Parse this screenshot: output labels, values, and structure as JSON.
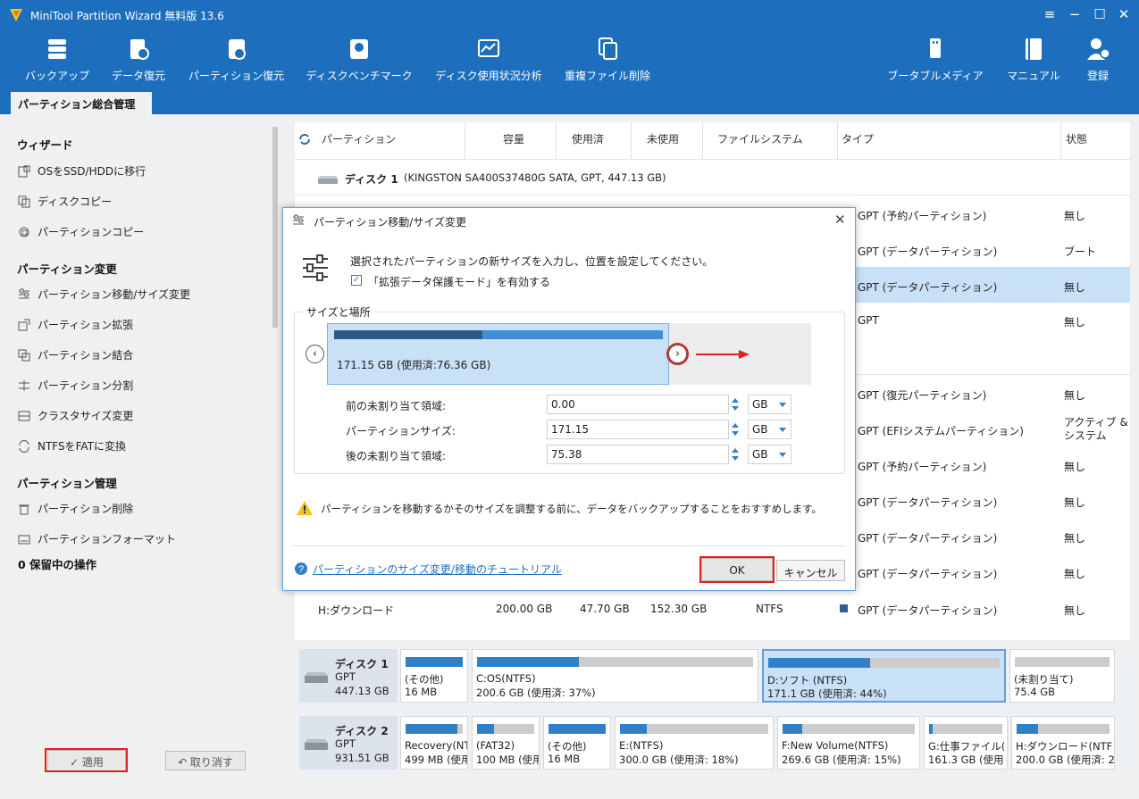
{
  "app": {
    "title": "MiniTool Partition Wizard 無料版 13.6"
  },
  "toolbar": {
    "items": [
      "バックアップ",
      "データ復元",
      "パーティション復元",
      "ディスクベンチマーク",
      "ディスク使用状況分析",
      "重複ファイル削除"
    ],
    "right_items": [
      "ブータブルメディア",
      "マニュアル",
      "登録"
    ]
  },
  "tab": {
    "label": "パーティション総合管理"
  },
  "sidebar": {
    "wizard_header": "ウィザード",
    "wizard_items": [
      "OSをSSD/HDDに移行",
      "ディスクコピー",
      "パーティションコピー"
    ],
    "change_header": "パーティション変更",
    "change_items": [
      "パーティション移動/サイズ変更",
      "パーティション拡張",
      "パーティション結合",
      "パーティション分割",
      "クラスタサイズ変更",
      "NTFSをFATに変換"
    ],
    "manage_header": "パーティション管理",
    "manage_items": [
      "パーティション削除",
      "パーティションフォーマット"
    ],
    "pending": "0 保留中の操作",
    "apply_label": "✓ 適用",
    "undo_label": "↶ 取り消す"
  },
  "table": {
    "headers": [
      "パーティション",
      "容量",
      "使用済",
      "未使用",
      "ファイルシステム",
      "タイプ",
      "状態"
    ],
    "disk1_label": "ディスク 1",
    "disk1_info": "(KINGSTON SA400S37480G SATA, GPT, 447.13 GB)",
    "rows_top": [
      {
        "type": "GPT (予約パーティション)",
        "status": "無し"
      },
      {
        "type": "GPT (データパーティション)",
        "status": "ブート"
      },
      {
        "type": "GPT (データパーティション)",
        "status": "無し"
      },
      {
        "type": "GPT",
        "status": "無し"
      }
    ],
    "rows_bottom": [
      {
        "type": "GPT (復元パーティション)",
        "status": "無し"
      },
      {
        "type": "GPT (EFIシステムパーティション)",
        "status": "アクティブ & システム"
      },
      {
        "type": "GPT (予約パーティション)",
        "status": "無し"
      },
      {
        "type": "GPT (データパーティション)",
        "status": "無し"
      },
      {
        "type": "GPT (データパーティション)",
        "status": "無し"
      },
      {
        "type": "GPT (データパーティション)",
        "status": "無し"
      }
    ],
    "last_row": {
      "name": "H:ダウンロード",
      "capacity": "200.00 GB",
      "used": "47.70 GB",
      "unused": "152.30 GB",
      "fs": "NTFS",
      "type": "GPT (データパーティション)",
      "status": "無し"
    }
  },
  "diskmap": {
    "disk1": {
      "name": "ディスク 1",
      "type": "GPT",
      "size": "447.13 GB",
      "parts": [
        {
          "name": "(その他)",
          "info": "16 MB",
          "fill": 1.0
        },
        {
          "name": "C:OS(NTFS)",
          "info": "200.6 GB (使用済: 37%)",
          "fill": 0.37
        },
        {
          "name": "D:ソフト (NTFS)",
          "info": "171.1 GB (使用済: 44%)",
          "fill": 0.44
        },
        {
          "name": "(未割り当て)",
          "info": "75.4 GB",
          "fill": 0.0
        }
      ]
    },
    "disk2": {
      "name": "ディスク 2",
      "type": "GPT",
      "size": "931.51 GB",
      "parts": [
        {
          "name": "Recovery(NT",
          "info": "499 MB (使用",
          "fill": 0.9
        },
        {
          "name": "(FAT32)",
          "info": "100 MB (使用",
          "fill": 0.3
        },
        {
          "name": "(その他)",
          "info": "16 MB",
          "fill": 1.0
        },
        {
          "name": "E:(NTFS)",
          "info": "300.0 GB (使用済: 18%)",
          "fill": 0.18
        },
        {
          "name": "F:New Volume(NTFS)",
          "info": "269.6 GB (使用済: 15%)",
          "fill": 0.15
        },
        {
          "name": "G:仕事ファイル(",
          "info": "161.3 GB (使用",
          "fill": 0.05
        },
        {
          "name": "H:ダウンロード(NTF",
          "info": "200.0 GB (使用済: 23",
          "fill": 0.23
        }
      ]
    }
  },
  "dialog": {
    "title": "パーティション移動/サイズ変更",
    "description": "選択されたパーティションの新サイズを入力し、位置を設定してください。",
    "checkbox_label": "「拡張データ保護モード」を有効する",
    "checkbox_checked": true,
    "group_label": "サイズと場所",
    "partition_text": "171.15 GB (使用済:76.36 GB)",
    "used_fraction": 0.45,
    "fields": [
      {
        "label": "前の未割り当て領域:",
        "value": "0.00",
        "unit": "GB"
      },
      {
        "label": "パーティションサイズ:",
        "value": "171.15",
        "unit": "GB"
      },
      {
        "label": "後の未割り当て領域:",
        "value": "75.38",
        "unit": "GB"
      }
    ],
    "warning": "パーティションを移動するかそのサイズを調整する前に、データをバックアップすることをおすすめします。",
    "tutorial_link": "パーティションのサイズ変更/移動のチュートリアル",
    "ok_label": "OK",
    "cancel_label": "キャンセル"
  },
  "colors": {
    "accent": "#1d6fbd",
    "bar": "#2f7fc9",
    "highlight": "#c9e1f7",
    "red": "#e02020"
  }
}
